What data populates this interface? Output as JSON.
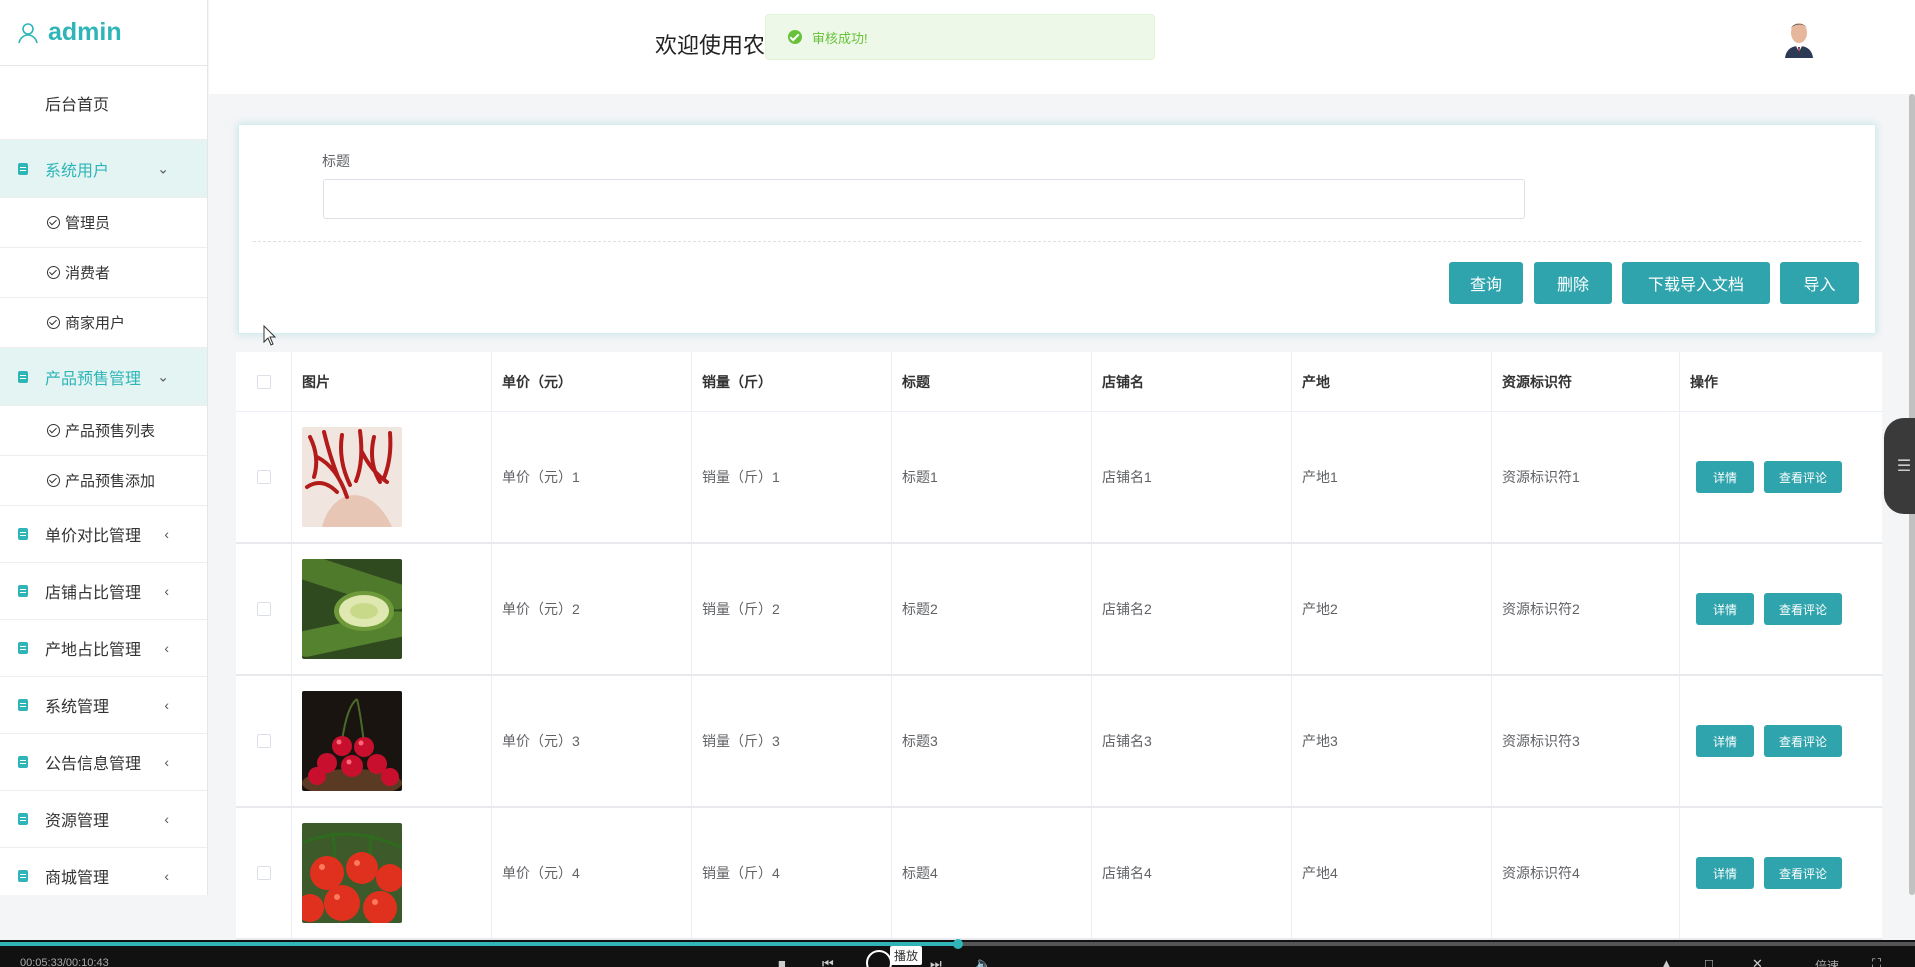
{
  "brand": {
    "title": "admin"
  },
  "sidebar": {
    "home": "后台首页",
    "groups": [
      {
        "label": "系统用户",
        "children": [
          "管理员",
          "消费者",
          "商家用户"
        ]
      },
      {
        "label": "产品预售管理",
        "children": [
          "产品预售列表",
          "产品预售添加"
        ]
      },
      {
        "label": "单价对比管理"
      },
      {
        "label": "店铺占比管理"
      },
      {
        "label": "产地占比管理"
      },
      {
        "label": "系统管理"
      },
      {
        "label": "公告信息管理"
      },
      {
        "label": "资源管理"
      },
      {
        "label": "商城管理"
      }
    ]
  },
  "header": {
    "welcome": "欢迎使用农"
  },
  "toast": {
    "message": "审核成功!"
  },
  "search": {
    "label": "标题",
    "value": "",
    "buttons": [
      "查询",
      "删除",
      "下载导入文档",
      "导入"
    ]
  },
  "table": {
    "headers": [
      "图片",
      "单价（元）",
      "销量（斤）",
      "标题",
      "店铺名",
      "产地",
      "资源标识符",
      "操作"
    ],
    "rows": [
      {
        "image": "chili-peppers",
        "price": "单价（元）1",
        "sales": "销量（斤）1",
        "title": "标题1",
        "shop": "店铺名1",
        "origin": "产地1",
        "uri": "资源标识符1"
      },
      {
        "image": "cucumbers",
        "price": "单价（元）2",
        "sales": "销量（斤）2",
        "title": "标题2",
        "shop": "店铺名2",
        "origin": "产地2",
        "uri": "资源标识符2"
      },
      {
        "image": "cherries",
        "price": "单价（元）3",
        "sales": "销量（斤）3",
        "title": "标题3",
        "shop": "店铺名3",
        "origin": "产地3",
        "uri": "资源标识符3"
      },
      {
        "image": "tomatoes",
        "price": "单价（元）4",
        "sales": "销量（斤）4",
        "title": "标题4",
        "shop": "店铺名4",
        "origin": "产地4",
        "uri": "资源标识符4"
      }
    ],
    "row_actions": [
      "详情",
      "查看评论"
    ]
  },
  "video": {
    "tooltip": "播放",
    "time": "00:05:33/00:10:43",
    "rate": "倍速",
    "progress": 0.5
  },
  "colors": {
    "accent": "#2fa4ad",
    "brand": "#2fb5b8",
    "success": "#67c23a"
  }
}
